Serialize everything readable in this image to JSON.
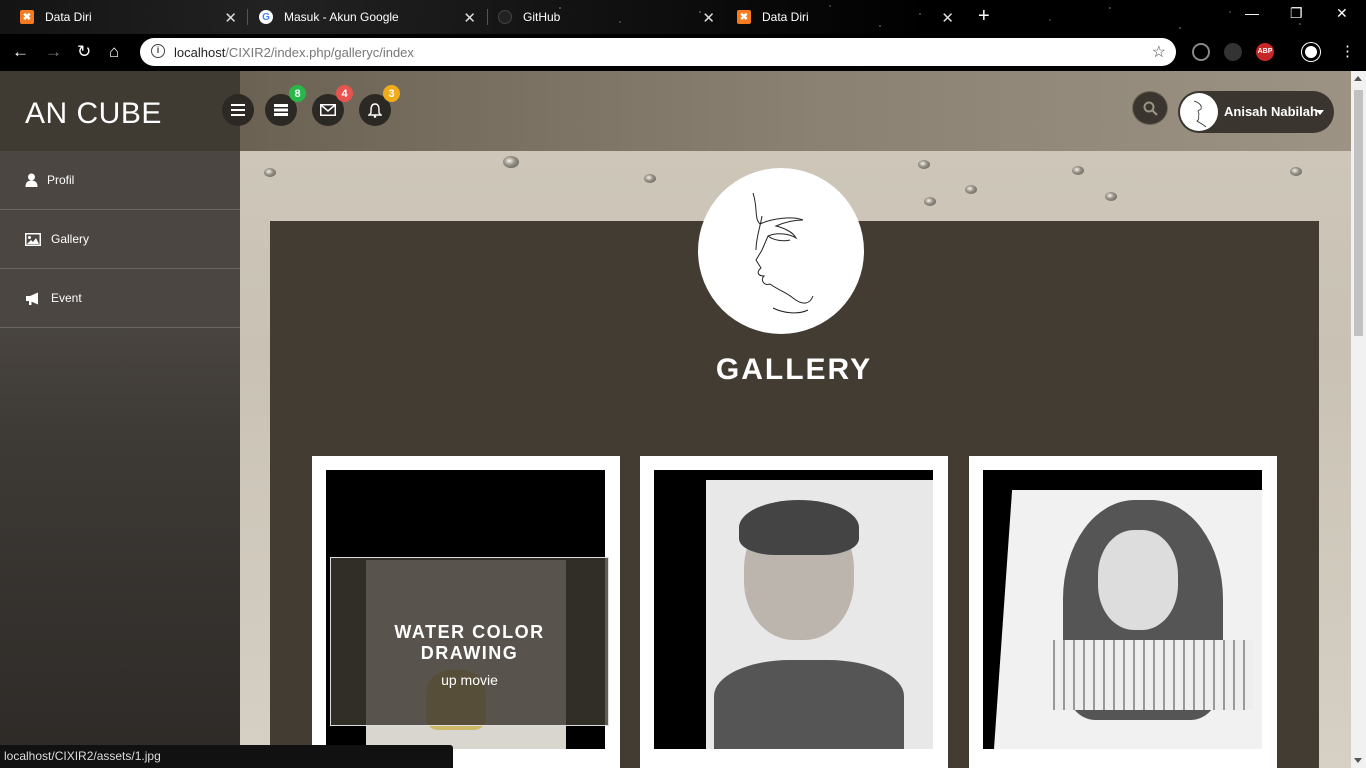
{
  "browser": {
    "tabs": [
      {
        "title": "Data Diri",
        "icon": "xampp-icon"
      },
      {
        "title": "Masuk - Akun Google",
        "icon": "google-icon"
      },
      {
        "title": "GitHub",
        "icon": "github-icon"
      },
      {
        "title": "Data Diri",
        "icon": "xampp-icon"
      }
    ],
    "url_host": "localhost",
    "url_path": "/CIXIR2/index.php/galleryc/index",
    "status_url": "localhost/CIXIR2/assets/1.jpg",
    "extensions": {
      "abp_label": "ABP"
    }
  },
  "header": {
    "brand": "AN CUBE",
    "badges": {
      "tasks": "8",
      "messages": "4",
      "notifications": "3"
    },
    "badge_colors": {
      "tasks": "#28b84a",
      "messages": "#e9534f",
      "notifications": "#f0ad1a"
    },
    "user_name": "Anisah Nabilah"
  },
  "sidebar": {
    "items": [
      {
        "label": "Profil",
        "icon": "user-icon"
      },
      {
        "label": "Gallery",
        "icon": "image-icon"
      },
      {
        "label": "Event",
        "icon": "megaphone-icon"
      }
    ]
  },
  "main": {
    "title": "GALLERY",
    "cards": [
      {
        "overlay_title": "WATER COLOR DRAWING",
        "overlay_subtitle": "up movie"
      },
      {},
      {}
    ]
  }
}
